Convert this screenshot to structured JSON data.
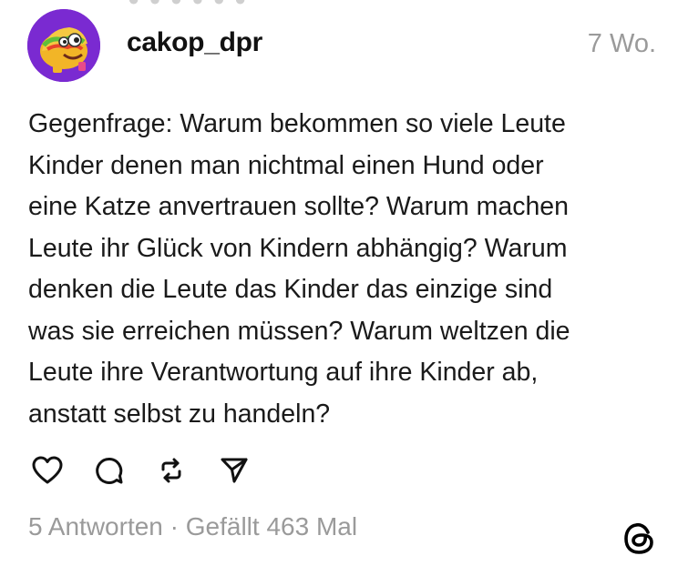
{
  "post": {
    "username": "cakop_dpr",
    "timestamp": "7 Wo.",
    "text": "Gegenfrage: Warum bekommen so viele Leute\nKinder denen man nichtmal einen Hund oder\neine Katze anvertrauen sollte? Warum machen\nLeute ihr Glück von Kindern abhängig? Warum\ndenken die Leute das Kinder das einzige sind\nwas sie erreichen müssen? Warum weltzen die\nLeute ihre Verantwortung auf ihre Kinder ab,\nanstatt selbst zu handeln?",
    "footer": "5 Antworten · Gefällt 463 Mal"
  },
  "actions": [
    {
      "icon": "heart-icon"
    },
    {
      "icon": "comment-icon"
    },
    {
      "icon": "repost-icon"
    },
    {
      "icon": "share-icon"
    }
  ],
  "colors": {
    "avatar_bg": "#7a2ad1",
    "muted_text": "#9a9a9a",
    "body_text": "#1a1a1a"
  }
}
